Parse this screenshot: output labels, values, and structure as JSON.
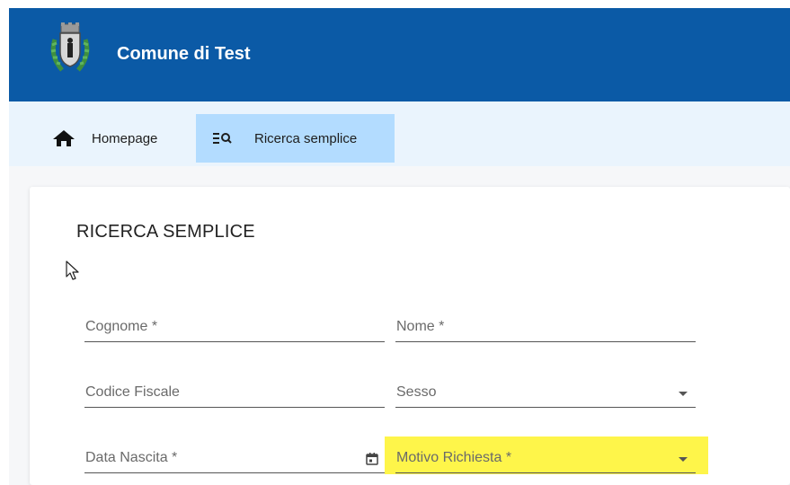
{
  "header": {
    "title": "Comune di Test",
    "logo": "municipal-coat-of-arms",
    "background_color": "#0b5aa6"
  },
  "nav": {
    "background_color": "#eaf4fd",
    "items": [
      {
        "label": "Homepage",
        "icon": "home-icon",
        "active": false
      },
      {
        "label": "Ricerca semplice",
        "icon": "list-search-icon",
        "active": true,
        "active_color": "#b3dcff"
      }
    ]
  },
  "page": {
    "title": "RICERCA SEMPLICE"
  },
  "form": {
    "cognome": {
      "label": "Cognome *",
      "value": ""
    },
    "nome": {
      "label": "Nome *",
      "value": ""
    },
    "codice_fiscale": {
      "label": "Codice Fiscale",
      "value": ""
    },
    "sesso": {
      "label": "Sesso",
      "value": "",
      "icon": "dropdown-arrow-icon"
    },
    "data_nascita": {
      "label": "Data Nascita *",
      "value": "",
      "icon": "calendar-icon"
    },
    "motivo_richiesta": {
      "label": "Motivo Richiesta *",
      "value": "",
      "icon": "dropdown-arrow-icon",
      "highlight_color": "#fef54a"
    }
  }
}
